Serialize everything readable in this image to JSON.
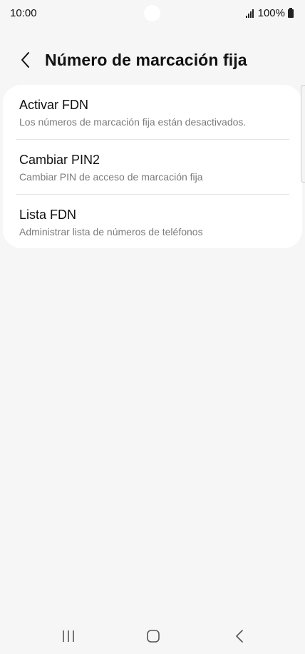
{
  "status_bar": {
    "time": "10:00",
    "battery": "100%"
  },
  "header": {
    "title": "Número de marcación fija"
  },
  "items": [
    {
      "title": "Activar FDN",
      "subtitle": "Los números de marcación fija están desactivados."
    },
    {
      "title": "Cambiar PIN2",
      "subtitle": "Cambiar PIN de acceso de marcación fija"
    },
    {
      "title": "Lista FDN",
      "subtitle": "Administrar lista de números de teléfonos"
    }
  ],
  "icons": {
    "back": "chevron-left-icon",
    "signal": "signal-bars-icon",
    "battery": "battery-icon",
    "nav_recents": "recents-icon",
    "nav_home": "home-icon",
    "nav_back": "back-icon"
  }
}
